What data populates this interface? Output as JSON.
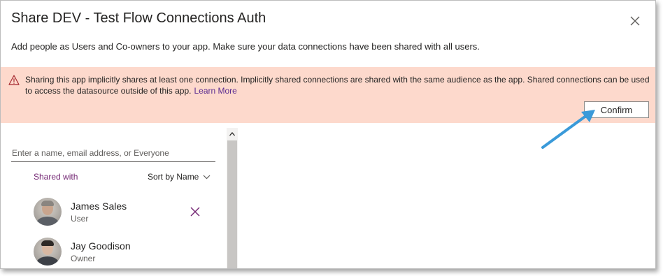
{
  "dialog": {
    "title": "Share DEV - Test Flow Connections Auth",
    "subtitle": "Add people as Users and Co-owners to your app. Make sure your data connections have been shared with all users."
  },
  "banner": {
    "message": "Sharing this app implicitly shares at least one connection. Implicitly shared connections are shared with the same audience as the app. Shared connections can be used to access the datasource outside of this app.",
    "learn_more": "Learn More",
    "confirm_label": "Confirm",
    "color": "#fdd9cc"
  },
  "search": {
    "placeholder": "Enter a name, email address, or Everyone"
  },
  "list": {
    "shared_with_label": "Shared with",
    "sort_label": "Sort by Name",
    "users": [
      {
        "name": "James Sales",
        "role": "User"
      },
      {
        "name": "Jay Goodison",
        "role": "Owner"
      }
    ]
  },
  "colors": {
    "accent": "#742774",
    "link": "#5c2d91",
    "callout_arrow": "#3a9ad9"
  },
  "icons": [
    "close-icon",
    "warning-icon",
    "chevron-down-icon",
    "remove-user-icon",
    "scroll-up-icon",
    "callout-arrow"
  ]
}
